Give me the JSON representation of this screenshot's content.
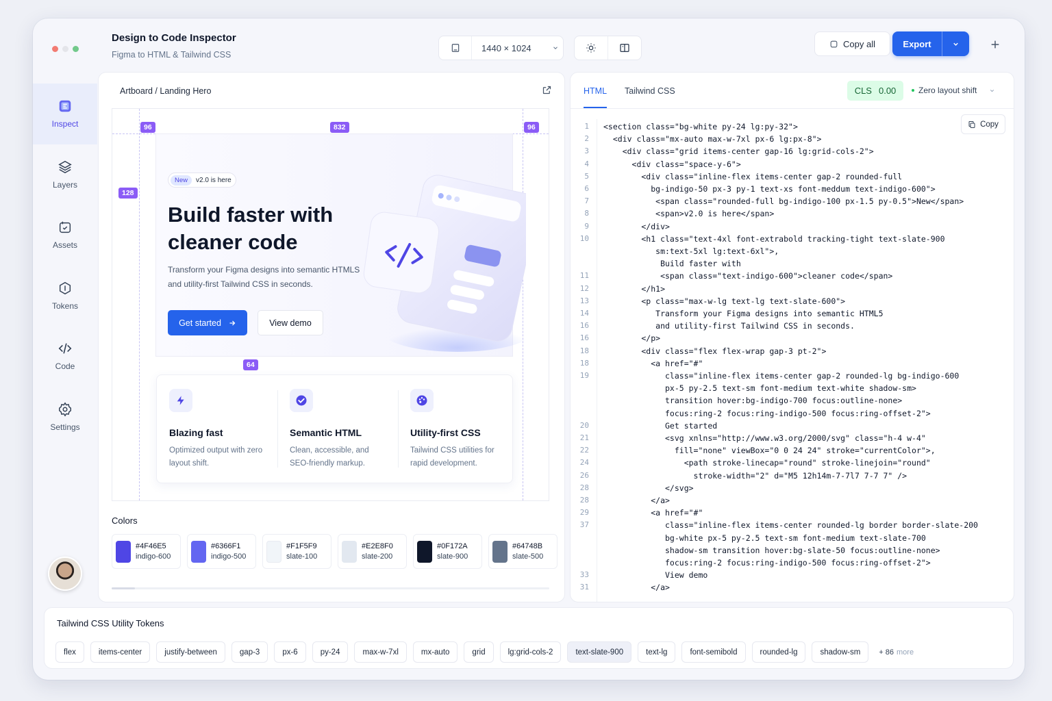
{
  "window": {
    "title": "Design to Code Inspector",
    "subtitle": "Figma to HTML & Tailwind CSS"
  },
  "toolbar": {
    "viewport": "1440 × 1024",
    "copy_all": "Copy all",
    "export": "Export"
  },
  "sidebar": {
    "items": [
      {
        "label": "Inspect",
        "icon": "inspect-icon",
        "active": true
      },
      {
        "label": "Layers",
        "icon": "layers-icon"
      },
      {
        "label": "Assets",
        "icon": "assets-icon"
      },
      {
        "label": "Tokens",
        "icon": "tokens-icon"
      },
      {
        "label": "Code",
        "icon": "code-icon"
      },
      {
        "label": "Settings",
        "icon": "gear-icon"
      }
    ]
  },
  "preview": {
    "breadcrumb": "Artboard / Landing Hero",
    "spacing_tags": {
      "left": "96",
      "width": "832",
      "right": "96",
      "top": "128",
      "gap": "64"
    },
    "hero": {
      "badge_new": "New",
      "badge_text": "v2.0 is here",
      "heading_line1": "Build faster with",
      "heading_line2": "cleaner code",
      "lead_line1": "Transform your Figma designs into semantic HTMLS",
      "lead_line2": "and utility-first Tailwind CSS in seconds.",
      "primary_cta": "Get started",
      "secondary_cta": "View demo"
    },
    "features": [
      {
        "title": "Blazing fast",
        "desc": "Optimized output with zero layout shift.",
        "icon": "bolt-icon"
      },
      {
        "title": "Semantic HTML",
        "desc": "Clean, accessible, and SEO-friendly markup.",
        "icon": "check-circle-icon"
      },
      {
        "title": "Utility-first CSS",
        "desc": "Tailwind CSS utilities for rapid development.",
        "icon": "palette-icon"
      }
    ],
    "colors_title": "Colors",
    "colors": [
      {
        "hex": "#4F46E5",
        "name": "indigo-600",
        "swatch": "#4f46e5"
      },
      {
        "hex": "#6366F1",
        "name": "indigo-500",
        "swatch": "#6366f1"
      },
      {
        "hex": "#F1F5F9",
        "name": "slate-100",
        "swatch": "#f1f5f9"
      },
      {
        "hex": "#E2E8F0",
        "name": "slate-200",
        "swatch": "#e2e8f0"
      },
      {
        "hex": "#0F172A",
        "name": "slate-900",
        "swatch": "#0f172a"
      },
      {
        "hex": "#64748B",
        "name": "slate-500",
        "swatch": "#64748b"
      }
    ]
  },
  "code_panel": {
    "tabs": [
      "HTML",
      "Tailwind CSS"
    ],
    "cls_label": "CLS",
    "cls_value": "0.00",
    "zero_shift": "Zero layout shift",
    "copy": "Copy",
    "lines": [
      {
        "n": "1",
        "t": "<section class=\"bg-white py-24 lg:py-32\">"
      },
      {
        "n": "2",
        "t": "  <div class=\"mx-auto max-w-7xl px-6 lg:px-8\">"
      },
      {
        "n": "3",
        "t": "    <div class=\"grid items-center gap-16 lg:grid-cols-2\">"
      },
      {
        "n": "4",
        "t": "      <div class=\"space-y-6\">"
      },
      {
        "n": "5",
        "t": "        <div class=\"inline-flex items-center gap-2 rounded-full"
      },
      {
        "n": "6",
        "t": "          bg-indigo-50 px-3 py-1 text-xs font-meddum text-indigo-600\">"
      },
      {
        "n": "7",
        "t": "           <span class=\"rounded-full bg-indigo-100 px-1.5 py-0.5\">New</span>"
      },
      {
        "n": "8",
        "t": "           <span>v2.0 is here</span>"
      },
      {
        "n": "9",
        "t": "        </div>"
      },
      {
        "n": "10",
        "t": "        <h1 class=\"text-4xl font-extrabold tracking-tight text-slate-900"
      },
      {
        "n": "",
        "t": "           sm:text-5xl lg:text-6xl\">,"
      },
      {
        "n": "",
        "t": "            Build faster with"
      },
      {
        "n": "11",
        "t": "            <span class=\"text-indigo-600\">cleaner code</span>"
      },
      {
        "n": "12",
        "t": "        </h1>"
      },
      {
        "n": "13",
        "t": "        <p class=\"max-w-lg text-lg text-slate-600\">"
      },
      {
        "n": "14",
        "t": "           Transform your Figma designs into semantic HTML5"
      },
      {
        "n": "16",
        "t": "           and utility-first Tailwind CSS in seconds."
      },
      {
        "n": "16",
        "t": "        </p>"
      },
      {
        "n": "18",
        "t": "        <div class=\"flex flex-wrap gap-3 pt-2\">"
      },
      {
        "n": "18",
        "t": "          <a href=\"#\""
      },
      {
        "n": "19",
        "t": "             class=\"inline-flex items-center gap-2 rounded-lg bg-indigo-600"
      },
      {
        "n": "",
        "t": "             px-5 py-2.5 text-sm font-medium text-white shadow-sm>"
      },
      {
        "n": "",
        "t": "             transition hover:bg-indigo-700 focus:outline-none>"
      },
      {
        "n": "",
        "t": "             focus:ring-2 focus:ring-indigo-500 focus:ring-offset-2\">"
      },
      {
        "n": "20",
        "t": "             Get started"
      },
      {
        "n": "21",
        "t": "             <svg xnlns=\"http://www.w3.org/2000/svg\" class=\"h-4 w-4\""
      },
      {
        "n": "22",
        "t": "               fill=\"none\" viewBox=\"0 0 24 24\" stroke=\"currentColor\">,"
      },
      {
        "n": "24",
        "t": "                 <path stroke-linecap=\"round\" stroke-linejoin=\"round\""
      },
      {
        "n": "26",
        "t": "                   stroke-width=\"2\" d=\"M5 12h14m-7-7l7 7-7 7\" />"
      },
      {
        "n": "28",
        "t": "             </svg>"
      },
      {
        "n": "28",
        "t": "          </a>"
      },
      {
        "n": "29",
        "t": "          <a href=\"#\""
      },
      {
        "n": "37",
        "t": "             class=\"inline-flex items-center rounded-lg border border-slate-200"
      },
      {
        "n": "",
        "t": "             bg-white px-5 py-2.5 text-sm font-medium text-slate-700"
      },
      {
        "n": "",
        "t": "             shadow-sm transition hover:bg-slate-50 focus:outline-none>"
      },
      {
        "n": "",
        "t": "             focus:ring-2 focus:ring-indigo-500 focus:ring-offset-2\">"
      },
      {
        "n": "33",
        "t": "             View demo"
      },
      {
        "n": "31",
        "t": "          </a>"
      }
    ]
  },
  "tokens": {
    "title": "Tailwind CSS Utility Tokens",
    "items": [
      "flex",
      "items-center",
      "justify-between",
      "gap-3",
      "px-6",
      "py-24",
      "max-w-7xl",
      "mx-auto",
      "grid",
      "lg:grid-cols-2",
      "text-slate-900",
      "text-lg",
      "font-semibold",
      "rounded-lg",
      "shadow-sm"
    ],
    "highlighted": "text-slate-900",
    "more_count": "+ 86",
    "more_label": "more"
  },
  "colors": {
    "accent": "#2563eb",
    "brand": "#4f46e5",
    "spacing_tag": "#8b5cf6",
    "cls_bg": "#dcfce7"
  }
}
